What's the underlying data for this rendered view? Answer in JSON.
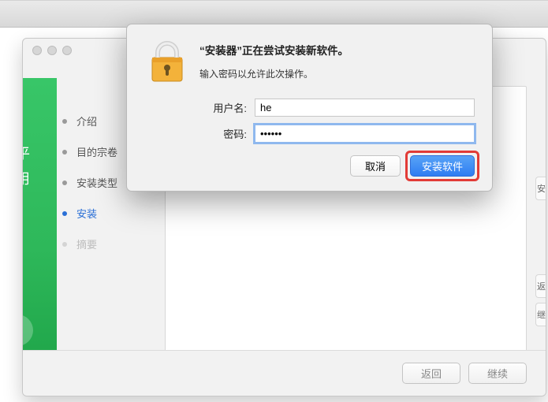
{
  "hero": {
    "line1": "训平",
    "line2": "易用"
  },
  "steps": [
    {
      "label": "介绍",
      "state": "past"
    },
    {
      "label": "目的宗卷",
      "state": "past"
    },
    {
      "label": "安装类型",
      "state": "past"
    },
    {
      "label": "安装",
      "state": "active"
    },
    {
      "label": "摘要",
      "state": "disabled"
    }
  ],
  "side_stubs": [
    "安钮",
    "返",
    "继"
  ],
  "footer": {
    "back": "返回",
    "continue": "继续"
  },
  "dialog": {
    "title": "“安装器”正在尝试安装新软件。",
    "subtitle": "输入密码以允许此次操作。",
    "user_label": "用户名:",
    "user_value": "he",
    "pass_label": "密码:",
    "pass_value": "••••••",
    "cancel": "取消",
    "confirm": "安装软件"
  }
}
